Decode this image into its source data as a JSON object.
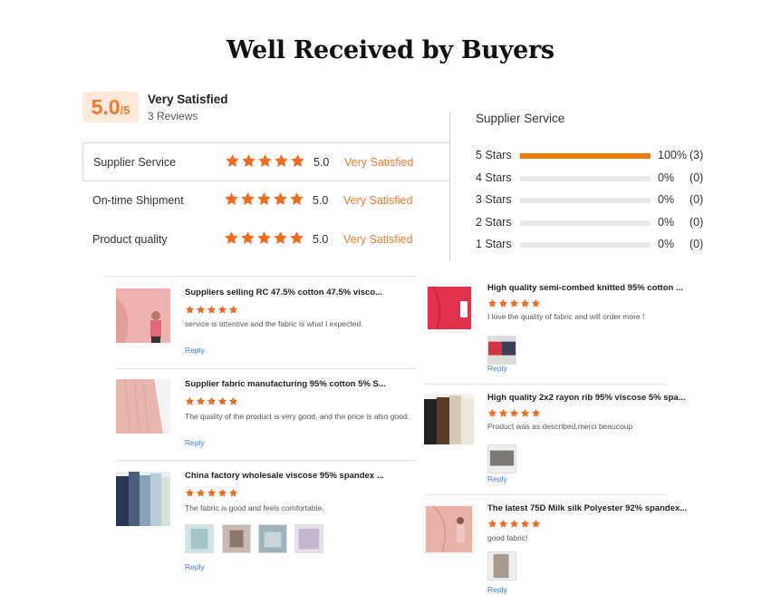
{
  "title": "Well Received by Buyers",
  "summary": {
    "score": "5.0",
    "score_max": "/5",
    "label": "Very Satisfied",
    "reviews": "3 Reviews"
  },
  "ratings": [
    {
      "label": "Supplier Service",
      "value": "5.0",
      "satisfaction": "Very Satisfied",
      "stars": 5
    },
    {
      "label": "On-time Shipment",
      "value": "5.0",
      "satisfaction": "Very Satisfied",
      "stars": 5
    },
    {
      "label": "Product quality",
      "value": "5.0",
      "satisfaction": "Very Satisfied",
      "stars": 5
    }
  ],
  "distribution": {
    "title": "Supplier Service",
    "rows": [
      {
        "label": "5  Stars",
        "percent": "100%",
        "count": "(3)",
        "fraction": 1.0
      },
      {
        "label": "4  Stars",
        "percent": "0%",
        "count": "(0)",
        "fraction": 0
      },
      {
        "label": "3  Stars",
        "percent": "0%",
        "count": "(0)",
        "fraction": 0
      },
      {
        "label": "2  Stars",
        "percent": "0%",
        "count": "(0)",
        "fraction": 0
      },
      {
        "label": "1  Stars",
        "percent": "0%",
        "count": "(0)",
        "fraction": 0
      }
    ]
  },
  "reviews_left": [
    {
      "title": "Suppliers selling RC 47.5% cotton 47.5% visco...",
      "text": "service is attentive and the fabric is what I expected.",
      "reply": "Reply",
      "stars": 5
    },
    {
      "title": "Supplier fabric manufacturing 95% cotton 5% S...",
      "text": "The quality of the product is very good, and the price is also good.",
      "reply": "Reply",
      "stars": 5
    },
    {
      "title": "China factory wholesale viscose 95% spandex ...",
      "text": "The fabric is good and feels comfortable.",
      "reply": "Reply",
      "stars": 5
    }
  ],
  "reviews_right": [
    {
      "title": "High quality semi-combed knitted 95% cotton ...",
      "text": "I love the quality of fabric and will order more !",
      "reply": "Reply",
      "stars": 5
    },
    {
      "title": "High quality 2x2 rayon rib 95% viscose 5% spa...",
      "text": "Product was as described,merci beaucoup",
      "reply": "Reply",
      "stars": 5
    },
    {
      "title": "The latest 75D Milk silk Polyester 92% spandex...",
      "text": "good fabric!",
      "reply": "Reply",
      "stars": 5
    }
  ],
  "colors": {
    "accent": "#f07a2b",
    "star": "#f26b1d",
    "link": "#3b7ddd"
  }
}
